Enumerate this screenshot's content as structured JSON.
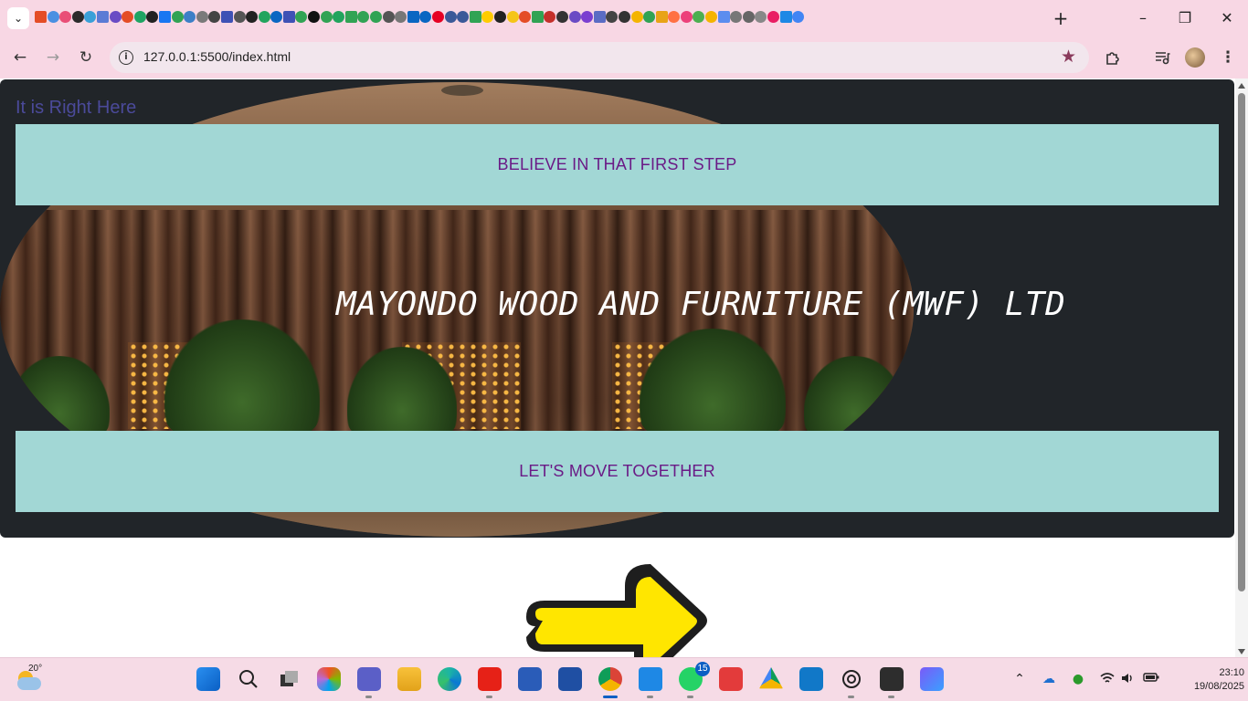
{
  "browser": {
    "tab_search_icon": "chevron-down-icon",
    "new_tab_label": "+",
    "window_controls": {
      "minimize": "–",
      "maximize": "❐",
      "close": "✕"
    },
    "url": "127.0.0.1:5500/index.html",
    "nav": {
      "back": "←",
      "forward": "→",
      "reload": "↻"
    },
    "bookmark_icon": "star-icon",
    "extensions_icon": "puzzle-icon",
    "media_icon": "media-control-icon",
    "menu_icon": "⋮",
    "favicon_colors": [
      "#e44d26",
      "#4a90e2",
      "#e94e77",
      "#2b2b2b",
      "#3aa0d8",
      "#5b7bd5",
      "#6a4bc4",
      "#e44d26",
      "#1fa463",
      "#222222",
      "#1877f2",
      "#31a354",
      "#3c7fc7",
      "#7a7a7a",
      "#444444",
      "#3f51b5",
      "#555555",
      "#222222",
      "#22a45d",
      "#0a66c2",
      "#3f51b5",
      "#31a354",
      "#111111",
      "#31a354",
      "#22a45d",
      "#31a354",
      "#31a354",
      "#31a354",
      "#555555",
      "#777777",
      "#0a66c2",
      "#0a66c2",
      "#e60023",
      "#3b5998",
      "#3b5998",
      "#31a354",
      "#ffcc00",
      "#222222",
      "#f5c518",
      "#e44d26",
      "#31a354",
      "#c4302b",
      "#333333",
      "#6a4bc4",
      "#7b3fd0",
      "#5b6cc4",
      "#444444",
      "#333333",
      "#f4b400",
      "#31a354",
      "#e8a317",
      "#ff7043",
      "#ec407a",
      "#4caf50",
      "#f4b400",
      "#5b8def",
      "#777777",
      "#666666",
      "#888888",
      "#e91e63",
      "#1e88e5",
      "#4285f4"
    ]
  },
  "page": {
    "brand": "It is Right Here",
    "band_top": "BELIEVE IN THAT FIRST STEP",
    "headline": "MAYONDO WOOD AND FURNITURE (MWF) LTD",
    "band_bottom": "LET'S MOVE TOGETHER",
    "accent_colors": {
      "band": "#a2d7d5",
      "band_text": "#6a1a86",
      "brand_text": "#4b4a9a",
      "hero_bg": "#212529",
      "arrow": "#ffe600"
    }
  },
  "taskbar": {
    "weather_temp": "20°",
    "whatsapp_badge": "15",
    "time": "23:10",
    "date": "19/08/2025",
    "apps": [
      "start-icon",
      "search-icon",
      "task-view-icon",
      "copilot-icon",
      "teams-icon",
      "file-explorer-icon",
      "edge-icon",
      "youtube-icon",
      "store-icon",
      "news-app-icon",
      "chrome-icon",
      "vscode-icon",
      "whatsapp-icon",
      "wps-office-icon",
      "drive-icon",
      "app-icon",
      "chatgpt-icon",
      "terminal-icon",
      "photos-icon"
    ],
    "tray": [
      "chevron-up-icon",
      "onedrive-icon",
      "status-icon",
      "wifi-icon",
      "volume-icon",
      "battery-icon"
    ]
  }
}
